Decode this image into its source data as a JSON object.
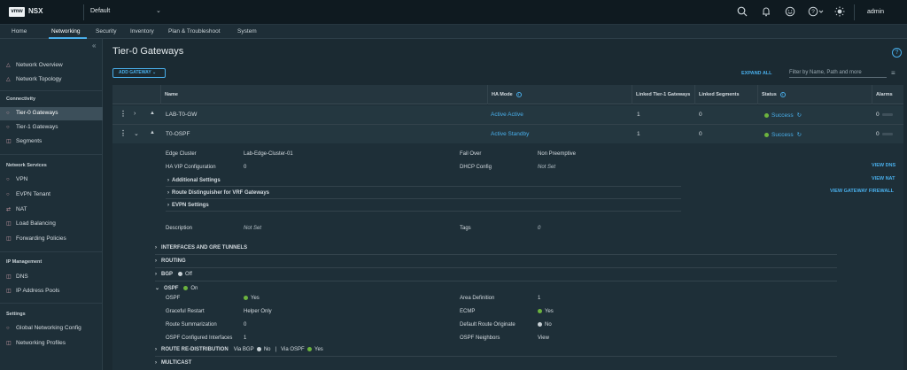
{
  "header": {
    "logo": "vmw",
    "app_name": "NSX",
    "tenant": "Default",
    "user": "admin"
  },
  "nav": {
    "tabs": [
      "Home",
      "Networking",
      "Security",
      "Inventory",
      "Plan & Troubleshoot",
      "System"
    ],
    "active": "Networking"
  },
  "sidebar": {
    "top_items": [
      "Network Overview",
      "Network Topology"
    ],
    "sections": [
      {
        "title": "Connectivity",
        "items": [
          "Tier-0 Gateways",
          "Tier-1 Gateways",
          "Segments"
        ]
      },
      {
        "title": "Network Services",
        "items": [
          "VPN",
          "EVPN Tenant",
          "NAT",
          "Load Balancing",
          "Forwarding Policies"
        ]
      },
      {
        "title": "IP Management",
        "items": [
          "DNS",
          "IP Address Pools"
        ]
      },
      {
        "title": "Settings",
        "items": [
          "Global Networking Config",
          "Networking Profiles"
        ]
      }
    ],
    "active_item": "Tier-0 Gateways"
  },
  "page": {
    "title": "Tier-0 Gateways",
    "add_button": "ADD GATEWAY",
    "expand_all": "EXPAND ALL",
    "filter_placeholder": "Filter by Name, Path and more"
  },
  "table": {
    "columns": [
      "Name",
      "HA Mode",
      "Linked Tier-1 Gateways",
      "Linked Segments",
      "Status",
      "Alarms"
    ],
    "rows": [
      {
        "name": "LAB-T0-GW",
        "ha_mode": "Active Active",
        "linked_t1": "1",
        "linked_segments": "0",
        "status": "Success",
        "alarms": "0"
      },
      {
        "name": "T0-OSPF",
        "ha_mode": "Active Standby",
        "linked_t1": "1",
        "linked_segments": "0",
        "status": "Success",
        "alarms": "0"
      }
    ]
  },
  "details": {
    "edge_cluster_label": "Edge Cluster",
    "edge_cluster_value": "Lab-Edge-Cluster-01",
    "fail_over_label": "Fail Over",
    "fail_over_value": "Non Preemptive",
    "ha_vip_label": "HA VIP Configuration",
    "ha_vip_value": "0",
    "dhcp_label": "DHCP Config",
    "dhcp_value": "Not Set",
    "additional_settings": "Additional Settings",
    "route_distinguisher": "Route Distinguisher for VRF Gateways",
    "evpn_settings": "EVPN Settings",
    "description_label": "Description",
    "description_value": "Not Set",
    "tags_label": "Tags",
    "tags_value": "0",
    "links": [
      "VIEW DNS",
      "VIEW NAT",
      "VIEW GATEWAY FIREWALL"
    ],
    "sections": {
      "interfaces": "INTERFACES AND GRE TUNNELS",
      "routing": "ROUTING",
      "bgp": "BGP",
      "bgp_state": "Off",
      "ospf": "OSPF",
      "ospf_state": "On",
      "redistribution": "ROUTE RE-DISTRIBUTION",
      "via_bgp_label": "Via BGP",
      "via_bgp_value": "No",
      "separator": "|",
      "via_ospf_label": "Via OSPF",
      "via_ospf_value": "Yes",
      "multicast": "MULTICAST"
    },
    "ospf": {
      "ospf_label": "OSPF",
      "ospf_value": "Yes",
      "area_label": "Area Definition",
      "area_value": "1",
      "graceful_label": "Graceful Restart",
      "graceful_value": "Helper Only",
      "ecmp_label": "ECMP",
      "ecmp_value": "Yes",
      "summarization_label": "Route Summarization",
      "summarization_value": "0",
      "default_route_label": "Default Route Originate",
      "default_route_value": "No",
      "configured_if_label": "OSPF Configured Interfaces",
      "configured_if_value": "1",
      "neighbors_label": "OSPF Neighbors",
      "neighbors_value": "View"
    }
  },
  "colors": {
    "accent": "#49aeea",
    "success": "#6cb33e",
    "background": "#1b2a32"
  }
}
